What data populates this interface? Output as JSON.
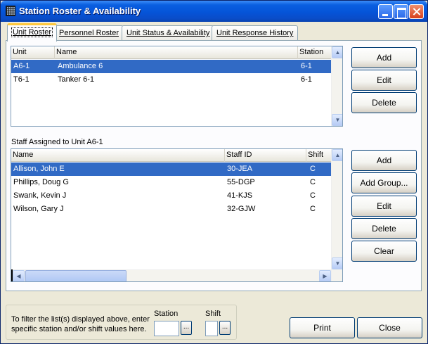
{
  "window": {
    "title": "Station Roster & Availability"
  },
  "tabs": [
    {
      "label": "Unit Roster",
      "active": true
    },
    {
      "label": "Personnel Roster",
      "active": false
    },
    {
      "label": "Unit Status & Availability",
      "active": false
    },
    {
      "label": "Unit Response History",
      "active": false
    }
  ],
  "units": {
    "columns": [
      "Unit",
      "Name",
      "Station"
    ],
    "rows": [
      {
        "unit": "A6-1",
        "name": "Ambulance 6",
        "station": "6-1",
        "selected": true
      },
      {
        "unit": "T6-1",
        "name": "Tanker 6-1",
        "station": "6-1",
        "selected": false
      }
    ],
    "buttons": {
      "add": "Add",
      "edit": "Edit",
      "delete": "Delete"
    }
  },
  "staff": {
    "section_label": "Staff Assigned to Unit A6-1",
    "columns": [
      "Name",
      "Staff ID",
      "Shift"
    ],
    "rows": [
      {
        "name": "Allison, John E",
        "staff_id": "30-JEA",
        "shift": "C",
        "selected": true
      },
      {
        "name": "Phillips, Doug G",
        "staff_id": "55-DGP",
        "shift": "C",
        "selected": false
      },
      {
        "name": "Swank, Kevin J",
        "staff_id": "41-KJS",
        "shift": "C",
        "selected": false
      },
      {
        "name": "Wilson, Gary J",
        "staff_id": "32-GJW",
        "shift": "C",
        "selected": false
      }
    ],
    "buttons": {
      "add": "Add",
      "add_group": "Add Group...",
      "edit": "Edit",
      "delete": "Delete",
      "clear": "Clear"
    }
  },
  "filter": {
    "instructions": "To filter the list(s) displayed above, enter specific station and/or shift values here.",
    "station_label": "Station",
    "station_value": "",
    "shift_label": "Shift",
    "shift_value": "",
    "browse_label": "..."
  },
  "footer": {
    "print": "Print",
    "close": "Close"
  },
  "colors": {
    "selection": "#316ac5",
    "titlebar": "#0554d8"
  }
}
